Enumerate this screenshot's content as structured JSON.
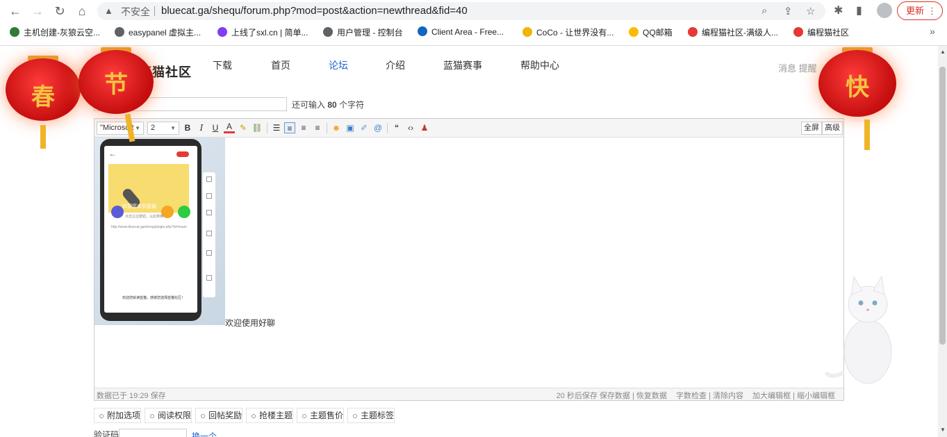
{
  "browser": {
    "address": {
      "insecure_label": "不安全",
      "url": "bluecat.ga/shequ/forum.php?mod=post&action=newthread&fid=40"
    },
    "update_label": "更新",
    "bookmarks": [
      {
        "label": "主机创建-灰狼云空...",
        "icon_color": "#2e7d32"
      },
      {
        "label": "easypanel 虚拟主...",
        "icon_color": "#5f6368"
      },
      {
        "label": "上线了sxl.cn | 简单...",
        "icon_color": "#7e3ff2"
      },
      {
        "label": "用户管理 - 控制台",
        "icon_color": "#5f6368"
      },
      {
        "label": "Client Area - Free...",
        "icon_color": "#1565c0"
      },
      {
        "label": "CoCo - 让世界没有...",
        "icon_color": "#f4b400"
      },
      {
        "label": "QQ邮箱",
        "icon_color": "#fbbc04"
      },
      {
        "label": "编程猫社区-满级人...",
        "icon_color": "#e53935"
      },
      {
        "label": "编程猫社区",
        "icon_color": "#e53935"
      }
    ],
    "more_label": "»"
  },
  "site": {
    "logo": "蓝猫社区",
    "nav": [
      "下载",
      "首页",
      "论坛",
      "介绍",
      "蓝猫赛事",
      "帮助中心"
    ],
    "active_nav": "论坛",
    "user_links": "消息   提醒"
  },
  "subject": {
    "hint_prefix": "还可输入",
    "hint_count": "80",
    "hint_suffix": "个字符"
  },
  "editor": {
    "font_name": "\"Microsoft",
    "font_size": "2",
    "fullscreen_label": "全屏",
    "advanced_label": "高级",
    "image_caption_top": "欢迎您来到蓝猫",
    "image_line1": "点击左边按钮，以此类推",
    "image_url": "http://www.bluecat.ga/shequ/plugin.php?id=exam",
    "image_bottom": "欢迎您就读蓝猫，感谢您选择蓝猫社区！",
    "welcome_text": "欢迎使用好聊",
    "status_left": "数据已于 19:29 保存",
    "status_autosave": "20 秒后保存 保存数据 | 恢复数据",
    "status_check": "字数检查 | 清除内容",
    "status_resize": "加大编辑框 | 缩小编辑框"
  },
  "options": [
    "附加选项",
    "阅读权限",
    "回帖奖励",
    "抢楼主题",
    "主题售价",
    "主题标签"
  ],
  "captcha": {
    "label": "验证码",
    "refresh": "换一个"
  },
  "decorations": {
    "lantern_chars": [
      "春",
      "节",
      "快"
    ]
  },
  "colors": {
    "accent": "#2266cc",
    "lantern_red": "#d81b1b",
    "update_red": "#d93025"
  }
}
